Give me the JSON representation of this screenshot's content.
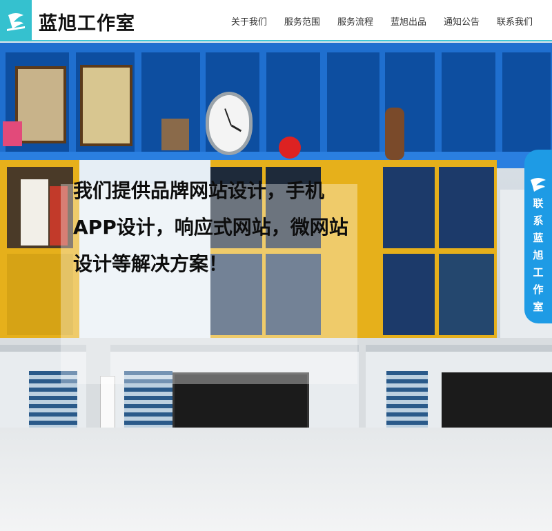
{
  "header": {
    "logo_title": "蓝旭工作室",
    "nav": [
      "关于我们",
      "服务范围",
      "服务流程",
      "蓝旭出品",
      "通知公告",
      "联系我们"
    ]
  },
  "hero": {
    "headline": "我们提供品牌网站设计，手机APP设计，响应式网站，微网站设计等解决方案！"
  },
  "contact": {
    "label": "联系蓝旭工作室"
  },
  "colors": {
    "accent": "#35c1cf",
    "contact_bg": "#1e9be5"
  }
}
